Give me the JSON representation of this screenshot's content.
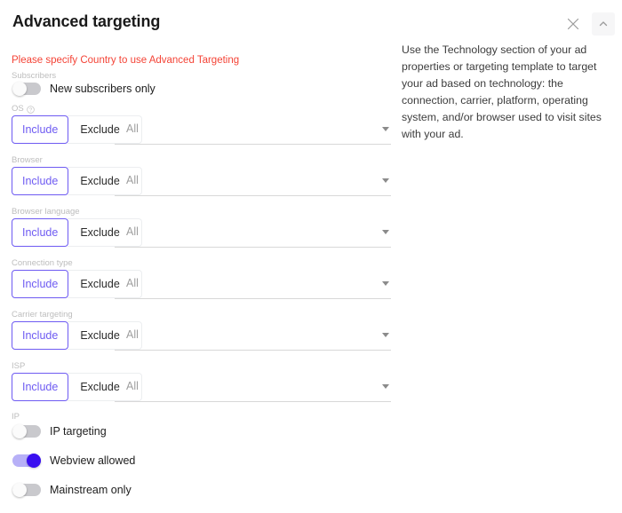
{
  "header": {
    "title": "Advanced targeting",
    "close_label": "Close",
    "collapse_label": "Collapse"
  },
  "form": {
    "error_message": "Please specify Country to use Advanced Targeting",
    "subscribers_label": "Subscribers",
    "subscribers_toggle": {
      "label": "New subscribers only",
      "state": "off"
    },
    "targeting_rows": [
      {
        "label": "OS",
        "has_help_icon": true,
        "include_label": "Include",
        "exclude_label": "Exclude",
        "selected": "Include",
        "select_value": "All"
      },
      {
        "label": "Browser",
        "has_help_icon": false,
        "include_label": "Include",
        "exclude_label": "Exclude",
        "selected": "Include",
        "select_value": "All"
      },
      {
        "label": "Browser language",
        "has_help_icon": false,
        "include_label": "Include",
        "exclude_label": "Exclude",
        "selected": "Include",
        "select_value": "All"
      },
      {
        "label": "Connection type",
        "has_help_icon": false,
        "include_label": "Include",
        "exclude_label": "Exclude",
        "selected": "Include",
        "select_value": "All"
      },
      {
        "label": "Carrier targeting",
        "has_help_icon": false,
        "include_label": "Include",
        "exclude_label": "Exclude",
        "selected": "Include",
        "select_value": "All"
      },
      {
        "label": "ISP",
        "has_help_icon": false,
        "include_label": "Include",
        "exclude_label": "Exclude",
        "selected": "Include",
        "select_value": "All"
      }
    ],
    "ip_label": "IP",
    "bottom_toggles": [
      {
        "label": "IP targeting",
        "state": "off"
      },
      {
        "label": "Webview allowed",
        "state": "on"
      },
      {
        "label": "Mainstream only",
        "state": "off"
      }
    ]
  },
  "help": {
    "text": "Use the Technology section of your ad properties or targeting template to target your ad based on technology: the connection, carrier, platform, operating system, and/or browser used to visit sites with your ad."
  },
  "colors": {
    "accent": "#6e5bf2",
    "toggle_on": "#3a10f0",
    "error": "#f44336",
    "label_muted": "#bdbdbd"
  }
}
